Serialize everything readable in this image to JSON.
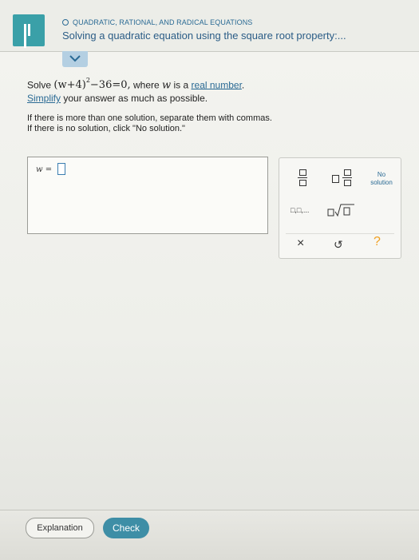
{
  "header": {
    "topic": "QUADRATIC, RATIONAL, AND RADICAL EQUATIONS",
    "lesson": "Solving a quadratic equation using the square root property:..."
  },
  "problem": {
    "solve_word": "Solve",
    "eq_left": "(w+4)",
    "eq_power": "2",
    "eq_right": "−36=0,",
    "where_text": "where",
    "var_name": "w",
    "is_a": "is a",
    "real_number_link": "real number",
    "period": ".",
    "simplify_link": "Simplify",
    "simplify_rest": "your answer as much as possible."
  },
  "instructions": {
    "line1": "If there is more than one solution, separate them with commas.",
    "line2": "If there is no solution, click \"No solution.\""
  },
  "answer": {
    "label": "w =",
    "value": ""
  },
  "keypad": {
    "no_solution_line1": "No",
    "no_solution_line2": "solution",
    "times_symbol": "×",
    "undo_symbol": "↺",
    "help_symbol": "?",
    "list_symbol": "□,□,..."
  },
  "footer": {
    "explanation_label": "Explanation",
    "check_label": "Check"
  },
  "colors": {
    "accent": "#3aa0a8",
    "link": "#2a6a94",
    "check": "#3e8ea6",
    "help": "#f0a020"
  }
}
